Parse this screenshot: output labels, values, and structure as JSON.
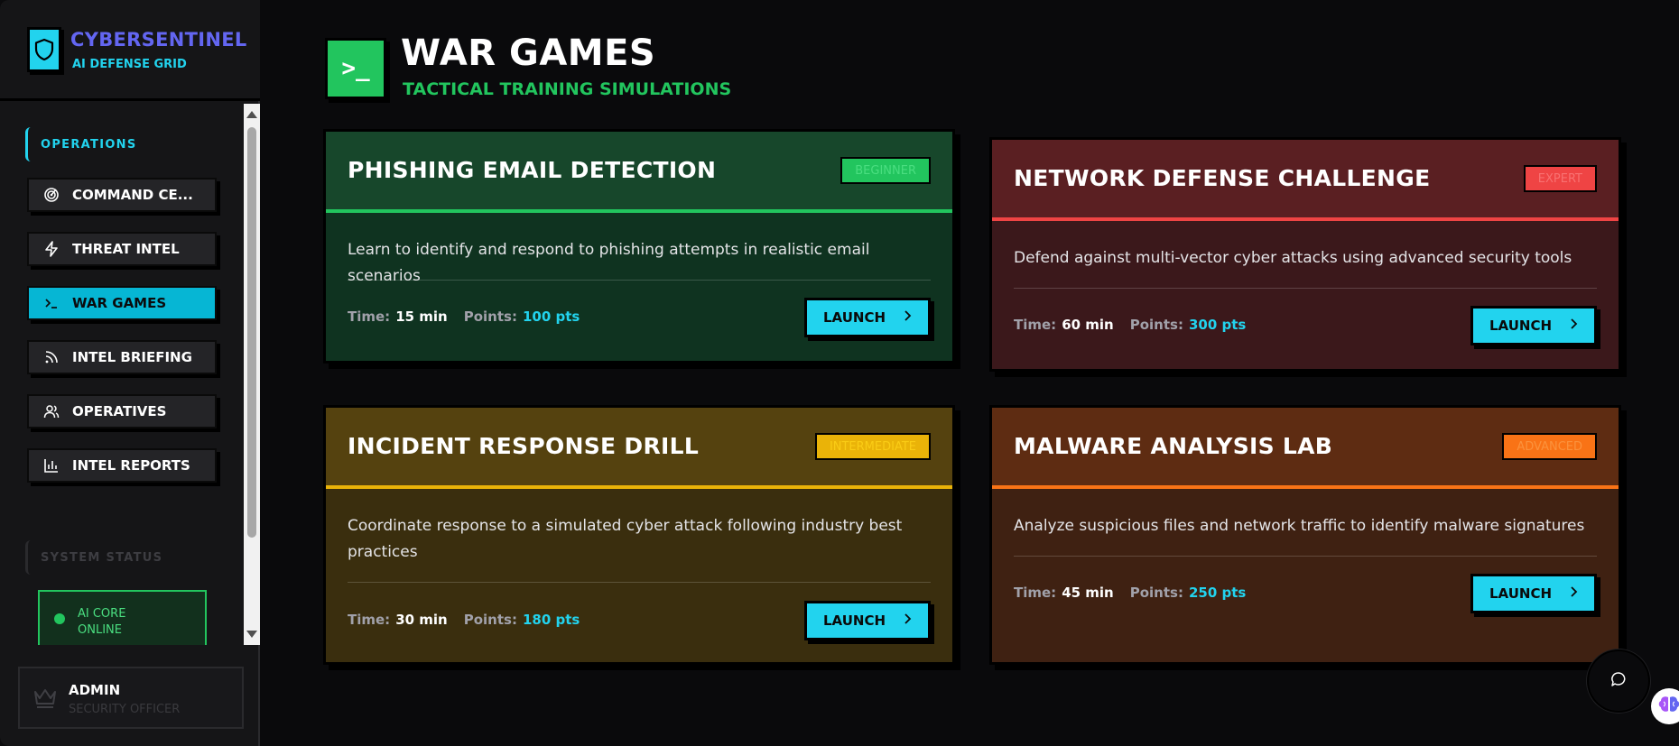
{
  "brand": {
    "title": "CYBERSENTINEL",
    "subtitle": "AI DEFENSE GRID"
  },
  "sidebar": {
    "section_operations": "OPERATIONS",
    "items": [
      {
        "label": "COMMAND CE...",
        "icon": "radar-icon",
        "active": false
      },
      {
        "label": "THREAT INTEL",
        "icon": "lightning-icon",
        "active": false
      },
      {
        "label": "WAR GAMES",
        "icon": "terminal-icon",
        "active": true
      },
      {
        "label": "INTEL BRIEFING",
        "icon": "rss-icon",
        "active": false
      },
      {
        "label": "OPERATIVES",
        "icon": "users-icon",
        "active": false
      },
      {
        "label": "INTEL REPORTS",
        "icon": "bar-chart-icon",
        "active": false
      }
    ],
    "section_status": "SYSTEM STATUS",
    "status": {
      "line1": "AI CORE",
      "line2": "ONLINE",
      "color": "#22c55e"
    }
  },
  "user": {
    "name": "ADMIN",
    "role": "SECURITY OFFICER"
  },
  "header": {
    "title": "WAR GAMES",
    "subtitle": "TACTICAL TRAINING SIMULATIONS",
    "icon": ">_"
  },
  "labels": {
    "time": "Time:",
    "points": "Points:",
    "launch": "LAUNCH"
  },
  "cards": [
    {
      "title": "PHISHING EMAIL DETECTION",
      "badge": "BEGINNER",
      "description": "Learn to identify and respond to phishing attempts in realistic email scenarios",
      "time": "15 min",
      "points": "100 pts",
      "colors": {
        "head": "#17472b",
        "body": "#0f3320",
        "accent": "#22c55e",
        "badge_bg": "#22c55e",
        "badge_text": "#4ade80"
      }
    },
    {
      "title": "NETWORK DEFENSE CHALLENGE",
      "badge": "EXPERT",
      "description": "Defend against multi-vector cyber attacks using advanced security tools",
      "time": "60 min",
      "points": "300 pts",
      "colors": {
        "head": "#5a1f22",
        "body": "#3b181b",
        "accent": "#ef4444",
        "badge_bg": "#ef4444",
        "badge_text": "#f87171"
      }
    },
    {
      "title": "INCIDENT RESPONSE DRILL",
      "badge": "INTERMEDIATE",
      "description": "Coordinate response to a simulated cyber attack following industry best practices",
      "time": "30 min",
      "points": "180 pts",
      "colors": {
        "head": "#55420f",
        "body": "#3a2e0e",
        "accent": "#eab308",
        "badge_bg": "#eab308",
        "badge_text": "#facc15"
      }
    },
    {
      "title": "MALWARE ANALYSIS LAB",
      "badge": "ADVANCED",
      "description": "Analyze suspicious files and network traffic to identify malware signatures",
      "time": "45 min",
      "points": "250 pts",
      "colors": {
        "head": "#5e2c12",
        "body": "#3f2112",
        "accent": "#f97316",
        "badge_bg": "#f97316",
        "badge_text": "#fb923c"
      }
    }
  ]
}
